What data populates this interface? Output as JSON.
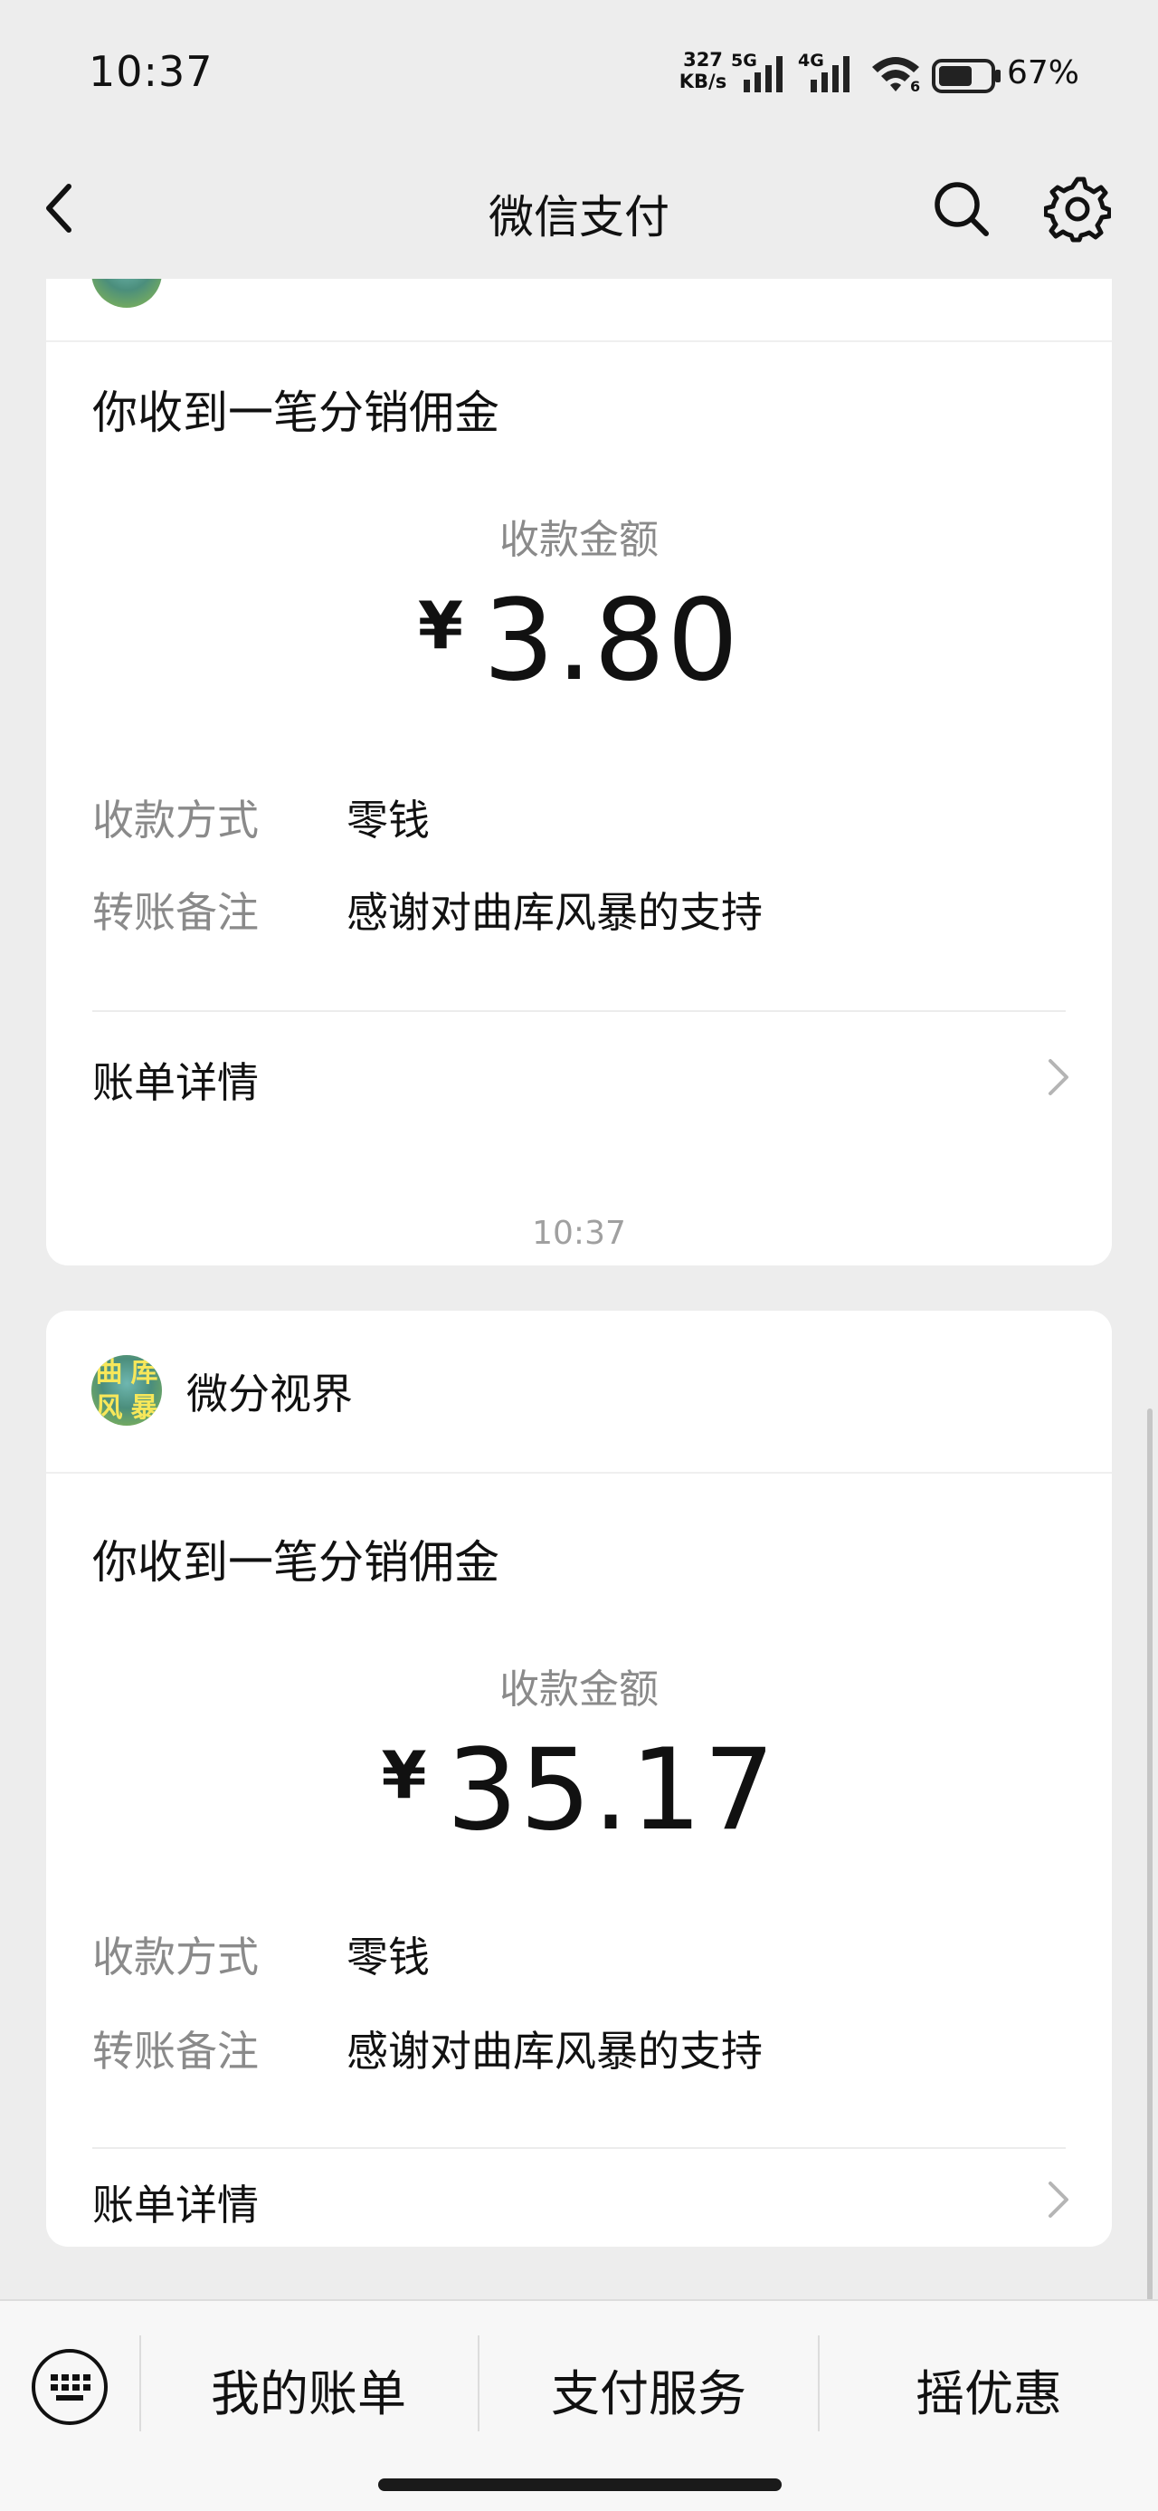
{
  "status_bar": {
    "time": "10:37",
    "net_speed_value": "327",
    "net_speed_unit": "KB/s",
    "sim1_label": "5G",
    "sim2_label": "4G",
    "wifi_badge": "6",
    "battery_percent": "67%",
    "battery_level": 0.67
  },
  "nav": {
    "title": "微信支付",
    "back_icon": "chevron-left-icon",
    "search_icon": "search-icon",
    "settings_icon": "gear-icon"
  },
  "messages": [
    {
      "merchant": "",
      "notice_title": "你收到一笔分销佣金",
      "amount_label": "收款金额",
      "currency": "¥",
      "amount": "3.80",
      "payment_method_key": "收款方式",
      "payment_method_value": "零钱",
      "remark_key": "转账备注",
      "remark_value": "感谢对曲库风暴的支持",
      "bill_details": "账单详情"
    },
    {
      "timestamp": "10:37",
      "merchant": "微分视界",
      "avatar_text": [
        "曲",
        "库",
        "风",
        "暴"
      ],
      "notice_title": "你收到一笔分销佣金",
      "amount_label": "收款金额",
      "currency": "¥",
      "amount": "35.17",
      "payment_method_key": "收款方式",
      "payment_method_value": "零钱",
      "remark_key": "转账备注",
      "remark_value": "感谢对曲库风暴的支持",
      "bill_details": "账单详情"
    }
  ],
  "bottom_bar": {
    "keyboard_icon": "keyboard-icon",
    "items": [
      {
        "label": "我的账单"
      },
      {
        "label": "支付服务"
      },
      {
        "label": "摇优惠"
      }
    ]
  },
  "colors": {
    "page_bg": "#ededed",
    "card_bg": "#ffffff",
    "muted_text": "#8a8a8a",
    "avatar_text": "#f7e75a"
  }
}
